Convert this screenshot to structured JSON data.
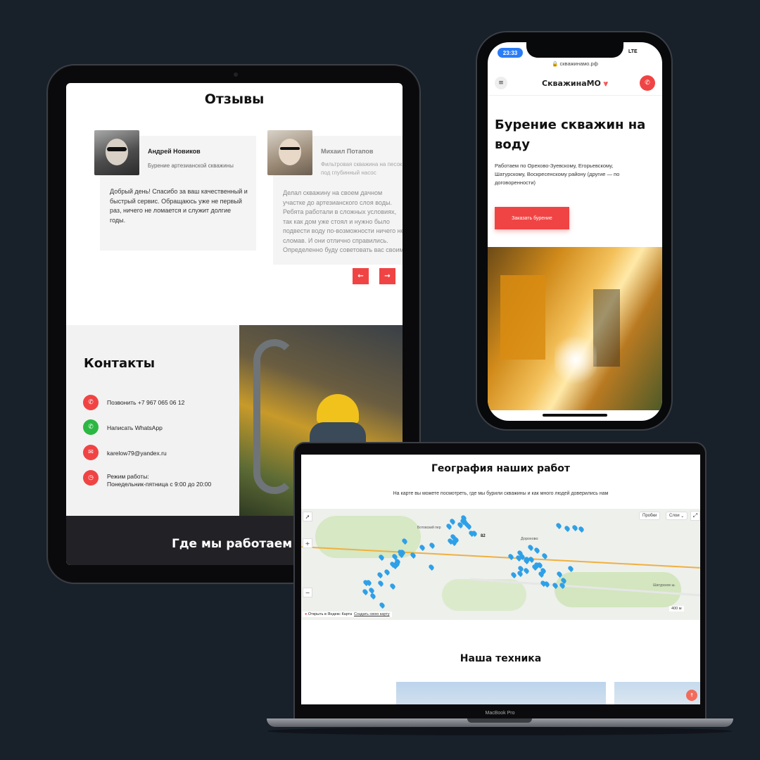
{
  "tablet": {
    "reviews_title": "Отзывы",
    "reviews": [
      {
        "name": "Андрей Новиков",
        "service": "Бурение артезианской скважины",
        "text": "Добрый день! Спасибо за ваш качественный и быстрый сервис. Обращаюсь уже не первый раз, ничего не ломается и служит долгие годы."
      },
      {
        "name": "Михаил Потапов",
        "service": "Фильтровая скважина на песок под глубинный насос",
        "text": "Делал скважину на своем дачном участке до артезианского слоя воды. Ребята работали в сложных условиях, так как дом уже стоял и нужно было подвести воду по-возможности ничего не сломав. И они отлично справились. Определенно буду советовать вас своим знакомым."
      }
    ],
    "prev_arrow": "←",
    "next_arrow": "→",
    "contacts_title": "Контакты",
    "contacts": {
      "phone": "Позвонить +7 967 065 06 12",
      "whatsapp": "Написать WhatsApp",
      "email": "karelow79@yandex.ru",
      "hours_label": "Режим работы:",
      "hours_value": "Понедельник-пятница с 9:00 до 20:00"
    },
    "footer_title": "Где мы работаем"
  },
  "phone": {
    "time": "23:33",
    "network": "LTE",
    "url": "🔒 скважинамо.рф",
    "logo": "СкважинаМО",
    "logo_mark": "⩔",
    "menu_icon": "≡",
    "call_icon": "✆",
    "hero_title": "Бурение скважин на воду",
    "hero_text": "Работаем по Орехово-Зуевскому, Егорьевскому, Шатурскому, Воскресенскому району (другие — по договоренности)",
    "cta": "Заказать бурение"
  },
  "laptop": {
    "geo_title": "География наших работ",
    "geo_subtitle": "На карте вы можете посмотреть, где мы бурили скважины и как много людей доверились нам",
    "map": {
      "traffic": "Пробки",
      "layers": "Слои",
      "zoom_in": "+",
      "zoom_out": "−",
      "open_link": "Открыть в Яндекс Картах",
      "create_map": "Создать свою карту",
      "scale": "400 м",
      "place_1": "Дорохово",
      "place_2": "Шатурское ш.",
      "place_3": "Ботовский пер",
      "cluster": "82"
    },
    "tech_title": "Наша техника",
    "macbook_label": "MacBook Pro",
    "scroll_top": "↑"
  },
  "colors": {
    "accent": "#f04444",
    "whatsapp": "#2cb742",
    "background": "#18202a",
    "map_pin": "#2ea0e8"
  }
}
